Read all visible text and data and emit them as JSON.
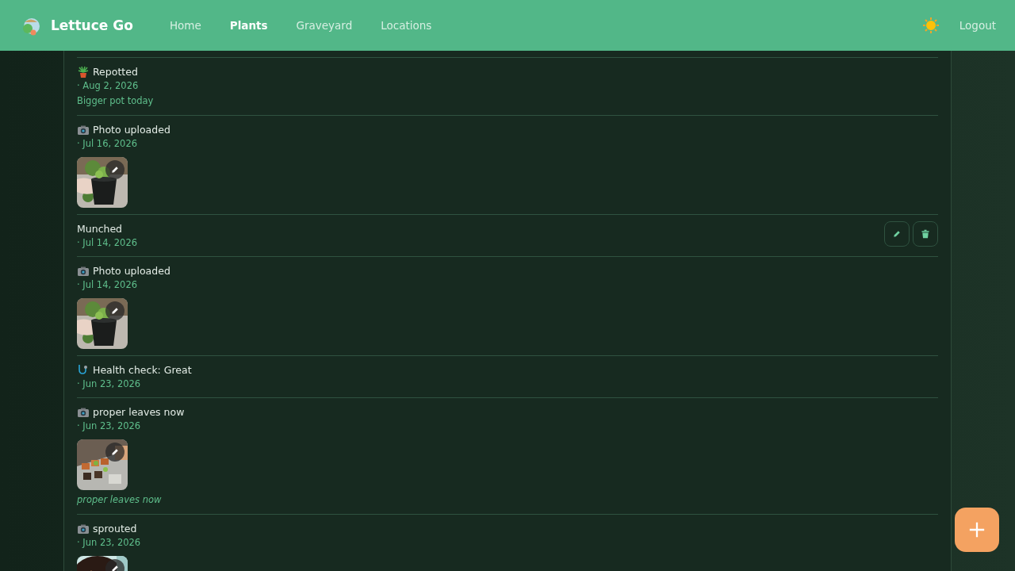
{
  "header": {
    "app_name": "Lettuce Go",
    "nav": [
      {
        "label": "Home",
        "selected": false
      },
      {
        "label": "Plants",
        "selected": true
      },
      {
        "label": "Graveyard",
        "selected": false
      },
      {
        "label": "Locations",
        "selected": false
      }
    ],
    "logout": "Logout"
  },
  "timeline": [
    {
      "kind": "plant",
      "title": "Repotted",
      "date": "· Aug 2, 2026",
      "note": "Bigger pot today",
      "editable": false
    },
    {
      "kind": "camera",
      "title": "Photo uploaded",
      "date": "· Jul 16, 2026",
      "editable": false
    },
    {
      "title": "Munched",
      "date": "· Jul 14, 2026",
      "editable": true
    },
    {
      "kind": "camera",
      "title": "Photo uploaded",
      "date": "· Jul 14, 2026",
      "editable": false
    },
    {
      "kind": "stethoscope",
      "title": "Health check: Great",
      "date": "· Jun 23, 2026",
      "editable": false
    },
    {
      "kind": "camera",
      "title": "proper leaves now",
      "date": "· Jun 23, 2026",
      "caption": "proper leaves now",
      "editable": false
    },
    {
      "kind": "camera",
      "title": "sprouted",
      "date": "· Jun 23, 2026",
      "editable": false
    }
  ]
}
